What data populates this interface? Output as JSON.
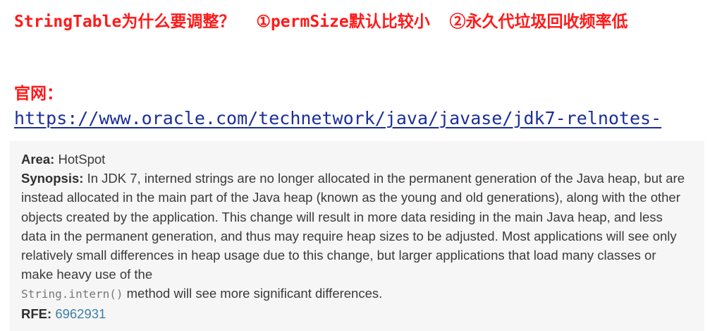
{
  "heading": {
    "title": "StringTable为什么要调整？",
    "reason_1": "①permSize默认比较小",
    "reason_2": "②永久代垃圾回收频率低"
  },
  "official_site": {
    "label": "官网：",
    "url": "https://www.oracle.com/technetwork/java/javase/jdk7-relnotes-"
  },
  "release_note": {
    "area_label": "Area:",
    "area_value": "HotSpot",
    "synopsis_label": "Synopsis:",
    "synopsis_text": "In JDK 7, interned strings are no longer allocated in the permanent generation of the Java heap, but are instead allocated in the main part of the Java heap (known as the young and old generations), along with the other objects created by the application. This change will result in more data residing in the main Java heap, and less data in the permanent generation, and thus may require heap sizes to be adjusted. Most applications will see only relatively small differences in heap usage due to this change, but larger applications that load many classes or make heavy use of the",
    "code": "String.intern()",
    "synopsis_tail": "method will see more significant differences.",
    "rfe_label": "RFE:",
    "rfe_id": "6962931"
  },
  "colors": {
    "heading": "#ff1a1a",
    "link": "#1b2e9a",
    "panel_background": "#f6f6f6",
    "rfe_link": "#3d7fa6"
  }
}
